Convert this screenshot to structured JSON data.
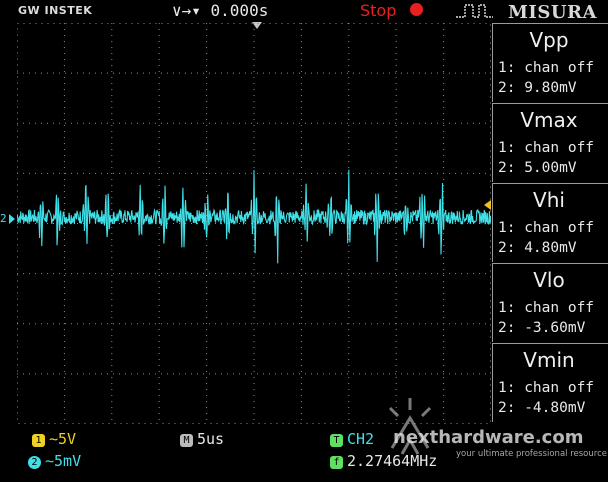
{
  "header": {
    "brand": "GW INSTEK",
    "trigger_position": "∨→▾ 0.000s",
    "run_state": "Stop",
    "overlay_logo": "MISURA"
  },
  "measurements": [
    {
      "title": "Vpp",
      "ch1": "1: chan off",
      "ch2": "2: 9.80mV"
    },
    {
      "title": "Vmax",
      "ch1": "1: chan off",
      "ch2": "2: 5.00mV"
    },
    {
      "title": "Vhi",
      "ch1": "1: chan off",
      "ch2": "2: 4.80mV"
    },
    {
      "title": "Vlo",
      "ch1": "1: chan off",
      "ch2": "2: -3.60mV"
    },
    {
      "title": "Vmin",
      "ch1": "1: chan off",
      "ch2": "2: -4.80mV"
    }
  ],
  "status": {
    "ch1_badge": "1",
    "ch1_scale": "∼5V",
    "ch2_badge": "2",
    "ch2_scale": "∼5mV",
    "timebase_badge": "M",
    "timebase": "5us",
    "trigger_badge": "T",
    "trigger_source": "CH2",
    "freq_badge": "f",
    "frequency": "2.27464MHz"
  },
  "channel_marker": "2",
  "waveform": {
    "color": "#40e0e8",
    "baseline_mV": 0,
    "noise_mV": 1.2,
    "spike_times_div": [
      0.5,
      0.85,
      1.45,
      1.9,
      2.6,
      3.1,
      3.5,
      4.0,
      4.45,
      5.0,
      5.5,
      6.1,
      6.6,
      7.0,
      7.6,
      8.2,
      8.55,
      8.95
    ],
    "spike_amp_mV": [
      3.5,
      -4.6,
      4.0,
      -4.2,
      3.8,
      -4.8,
      3.6,
      -4.4,
      4.2,
      5.0,
      -4.5,
      3.9,
      -3.8,
      4.1,
      -4.6,
      3.5,
      4.8,
      -4.2
    ]
  },
  "watermark": {
    "text": "nexthardware.com",
    "tagline": "your ultimate professional resource"
  }
}
